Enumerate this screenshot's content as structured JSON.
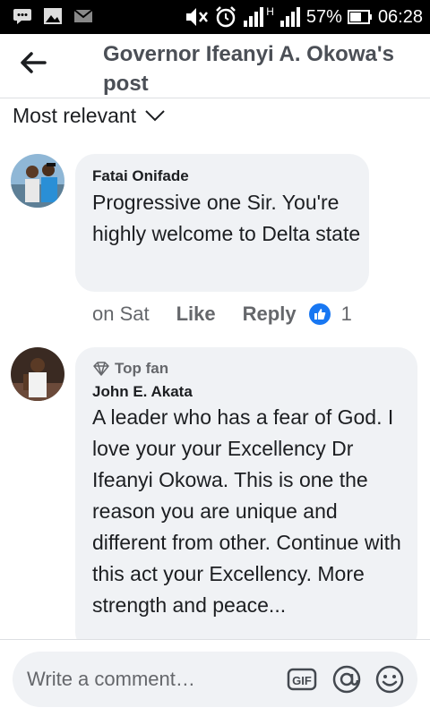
{
  "status_bar": {
    "battery": "57%",
    "time": "06:28",
    "network_label": "H"
  },
  "header": {
    "title": "Governor Ifeanyi A. Okowa's post"
  },
  "sort": {
    "label": "Most relevant"
  },
  "comments": [
    {
      "author": "Fatai Onifade",
      "text": "Progressive one Sir. You're highly welcome to Delta state",
      "time": "on Sat",
      "like_label": "Like",
      "reply_label": "Reply",
      "reaction_count": "1"
    },
    {
      "badge": "Top fan",
      "author": "John E. Akata",
      "text": "A leader who has a fear of God. I love your your Excellency Dr Ifeanyi Okowa. This is one the reason you are unique and different from other. Continue with this act your Excellency. More strength and peace..."
    }
  ],
  "composer": {
    "placeholder": "Write a comment…"
  },
  "colors": {
    "accent": "#1877f2",
    "bubble": "#f0f2f5",
    "header_text": "#4b4f56"
  }
}
